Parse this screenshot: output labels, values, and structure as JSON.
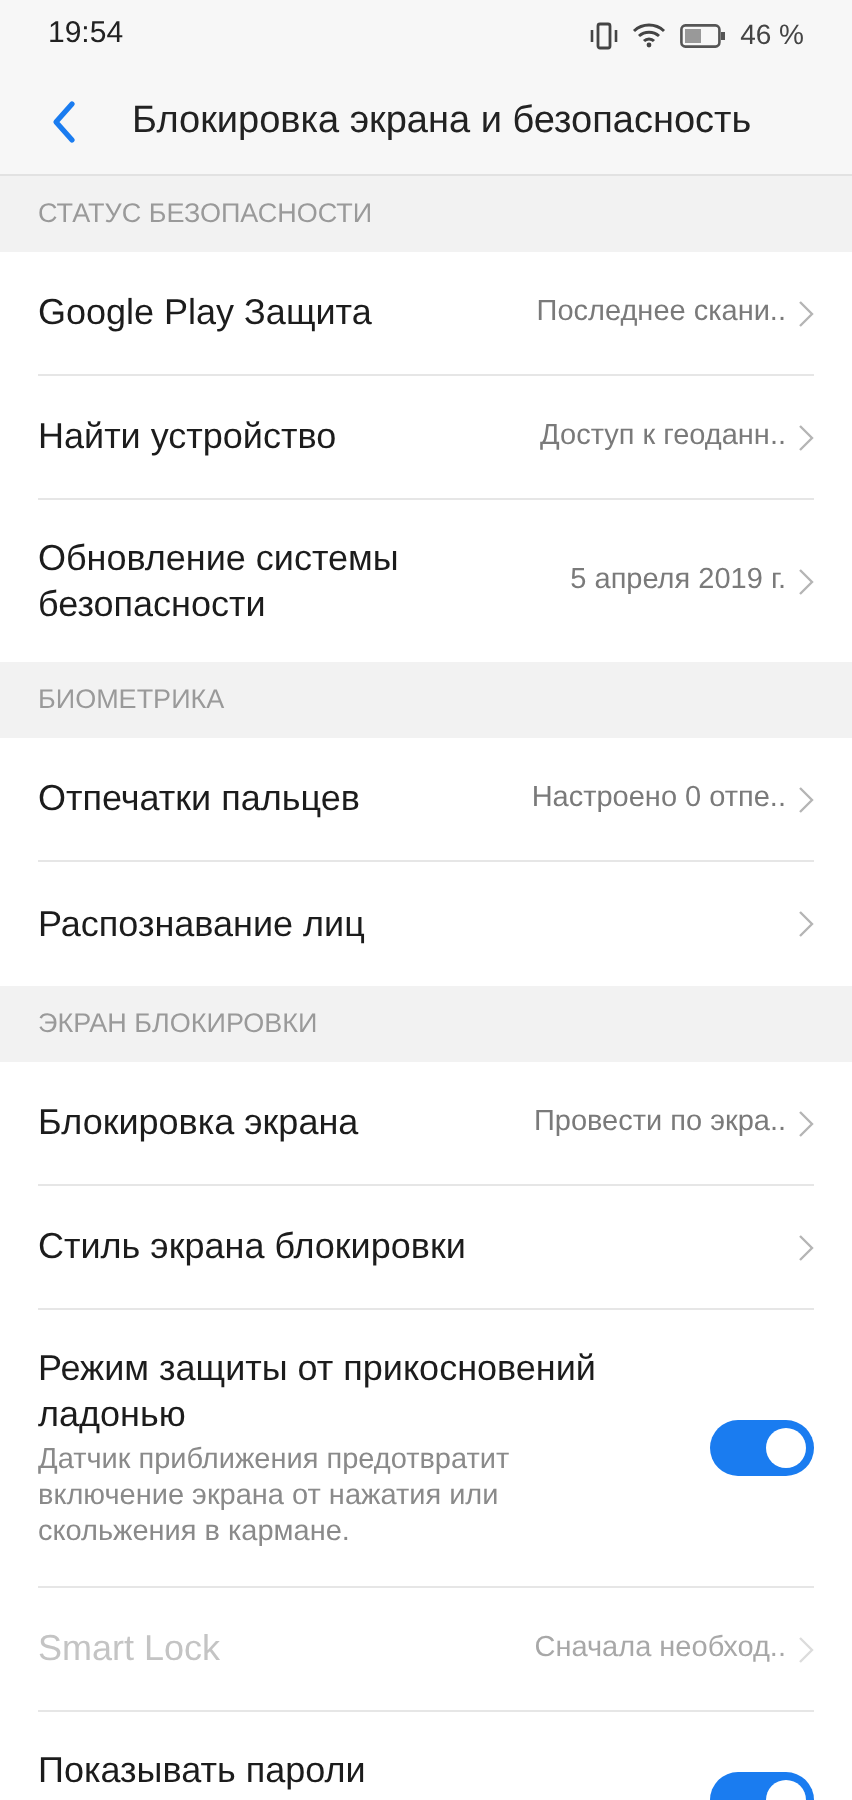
{
  "status_bar": {
    "time": "19:54",
    "battery": "46 %"
  },
  "header": {
    "title": "Блокировка экрана и безопасность"
  },
  "sections": [
    {
      "title": "СТАТУС БЕЗОПАСНОСТИ",
      "items": [
        {
          "kind": "link",
          "label": "Google Play Защита",
          "value": "Последнее скани..",
          "disabled": false
        },
        {
          "kind": "link",
          "label": "Найти устройство",
          "value": "Доступ к геоданн..",
          "disabled": false
        },
        {
          "kind": "link",
          "label": "Обновление системы безопасности",
          "value": "5 апреля 2019 г.",
          "disabled": false
        }
      ]
    },
    {
      "title": "БИОМЕТРИКА",
      "items": [
        {
          "kind": "link",
          "label": "Отпечатки пальцев",
          "value": "Настроено 0 отпе..",
          "disabled": false
        },
        {
          "kind": "link",
          "label": "Распознавание лиц",
          "disabled": false
        }
      ]
    },
    {
      "title": "ЭКРАН БЛОКИРОВКИ",
      "items": [
        {
          "kind": "link",
          "label": "Блокировка экрана",
          "value": "Провести по экра..",
          "disabled": false
        },
        {
          "kind": "link",
          "label": "Стиль экрана блокировки",
          "disabled": false
        },
        {
          "kind": "toggle",
          "label": "Режим защиты от прикосновений ладонью",
          "description": "Датчик приближения предотвратит включение экрана от нажатия или скольжения в кармане.",
          "on": true
        },
        {
          "kind": "link",
          "label": "Smart Lock",
          "value": "Сначала необход..",
          "disabled": true
        },
        {
          "kind": "toggle",
          "label": "Показывать пароли",
          "on": true
        }
      ]
    }
  ]
}
